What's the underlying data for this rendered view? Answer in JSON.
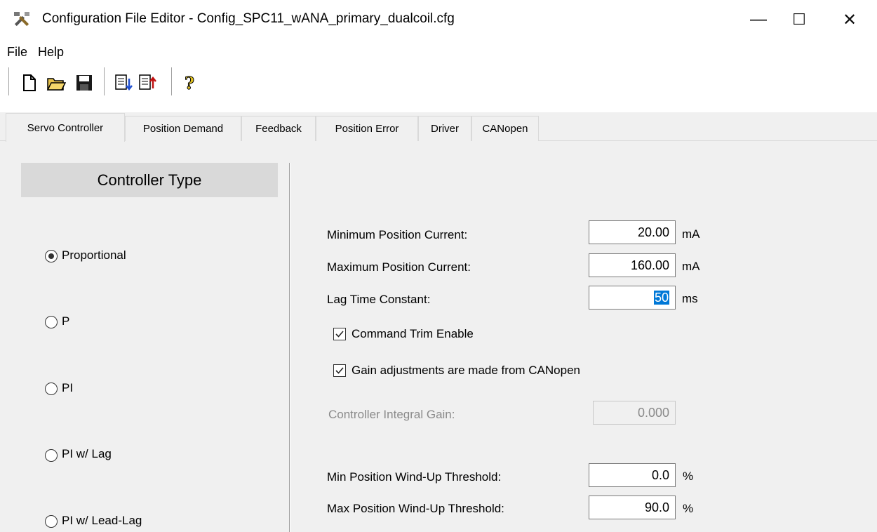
{
  "window": {
    "title": "Configuration File Editor - Config_SPC11_wANA_primary_dualcoil.cfg",
    "controls": {
      "minimize": "—",
      "maximize": "☐",
      "close": "✕"
    }
  },
  "menu": {
    "items": [
      "File",
      "Help"
    ]
  },
  "toolbar": {
    "icons": [
      "new-file-icon",
      "open-folder-icon",
      "save-disk-icon",
      "import-icon",
      "export-icon",
      "help-question-icon"
    ]
  },
  "tabs": [
    {
      "label": "Servo Controller",
      "active": true
    },
    {
      "label": "Position Demand",
      "active": false
    },
    {
      "label": "Feedback",
      "active": false
    },
    {
      "label": "Position Error",
      "active": false
    },
    {
      "label": "Driver",
      "active": false
    },
    {
      "label": "CANopen",
      "active": false
    }
  ],
  "controller_type": {
    "heading": "Controller Type",
    "options": [
      {
        "label": "Proportional",
        "selected": true
      },
      {
        "label": "P",
        "selected": false
      },
      {
        "label": "PI",
        "selected": false
      },
      {
        "label": "PI w/ Lag",
        "selected": false
      },
      {
        "label": "PI w/ Lead-Lag",
        "selected": false
      }
    ]
  },
  "fields": {
    "min_position_current": {
      "label": "Minimum Position Current:",
      "value": "20.00",
      "unit": "mA"
    },
    "max_position_current": {
      "label": "Maximum Position Current:",
      "value": "160.00",
      "unit": "mA"
    },
    "lag_time_constant": {
      "label": "Lag Time Constant:",
      "value": "50",
      "unit": "ms"
    },
    "controller_integral_gain": {
      "label": "Controller Integral Gain:",
      "value": "0.000",
      "disabled": true
    },
    "min_windup": {
      "label": "Min Position Wind-Up Threshold:",
      "value": "0.0",
      "unit": "%"
    },
    "max_windup": {
      "label": "Max Position Wind-Up Threshold:",
      "value": "90.0",
      "unit": "%"
    }
  },
  "checkboxes": {
    "command_trim_enable": {
      "label": "Command Trim Enable",
      "checked": true
    },
    "gain_from_canopen": {
      "label": "Gain adjustments are made from CANopen",
      "checked": true
    }
  },
  "colors": {
    "selection": "#0078d7",
    "heading_bg": "#d9d9d9",
    "panel_bg": "#f0f0f0"
  }
}
